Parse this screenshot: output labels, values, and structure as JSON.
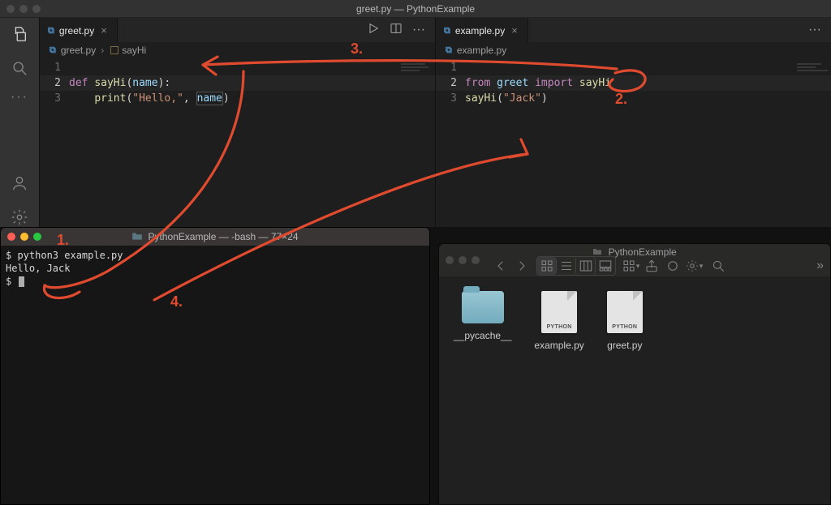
{
  "vscode": {
    "window_title": "greet.py — PythonExample",
    "panes": [
      {
        "tab_label": "greet.py",
        "breadcrumb_file": "greet.py",
        "breadcrumb_symbol": "sayHi",
        "lines": [
          "1",
          "2",
          "3"
        ],
        "code": {
          "l1_kw": "def ",
          "l1_fn": "sayHi",
          "l1_paren_open": "(",
          "l1_param": "name",
          "l1_paren_close": ")",
          "l1_colon": ":",
          "l2_indent": "    ",
          "l2_fn": "print",
          "l2_po": "(",
          "l2_str": "\"Hello,\"",
          "l2_comma": ", ",
          "l2_param": "name",
          "l2_pc": ")"
        }
      },
      {
        "tab_label": "example.py",
        "breadcrumb_file": "example.py",
        "lines": [
          "1",
          "2",
          "3"
        ],
        "code": {
          "l1_from": "from ",
          "l1_mod": "greet ",
          "l1_import": "import ",
          "l1_sym": "sayHi",
          "l2_fn": "sayHi",
          "l2_po": "(",
          "l2_str": "\"Jack\"",
          "l2_pc": ")"
        }
      }
    ]
  },
  "terminal": {
    "title": "PythonExample — -bash — 77×24",
    "lines": [
      "$ python3 example.py",
      "Hello, Jack",
      "$ "
    ]
  },
  "finder": {
    "title": "PythonExample",
    "items": [
      {
        "kind": "folder",
        "name": "__pycache__"
      },
      {
        "kind": "python",
        "name": "example.py",
        "badge": "PYTHON"
      },
      {
        "kind": "python",
        "name": "greet.py",
        "badge": "PYTHON"
      }
    ]
  },
  "annotations": {
    "a1": "1.",
    "a2": "2.",
    "a3": "3.",
    "a4": "4."
  }
}
